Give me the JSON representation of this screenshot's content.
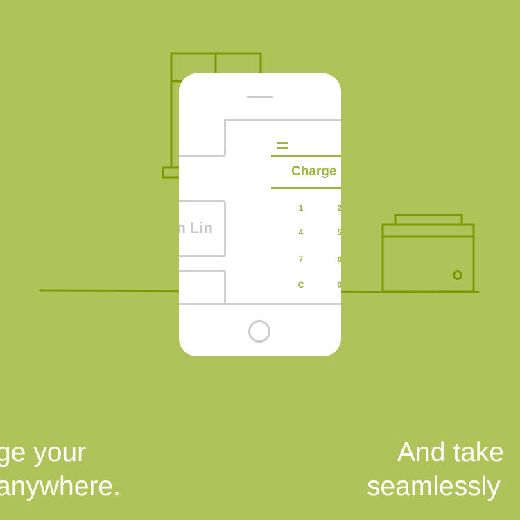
{
  "colors": {
    "background": "#b0c35a",
    "line_art": "#7a9a05",
    "accent": "#9cb43c",
    "phone": "#ffffff",
    "phone_gray": "#cfcfcf",
    "caption": "#ffffff"
  },
  "illustration": {
    "left_object_icon": "register-stand-icon",
    "right_object_icon": "cash-drawer-icon"
  },
  "phone_screen": {
    "menu_icon": "hamburger-menu-icon",
    "list_cards": [
      "",
      "n Lin",
      ""
    ],
    "charge_label": "Charge",
    "keypad": [
      [
        "1",
        "2"
      ],
      [
        "4",
        "5"
      ],
      [
        "7",
        "8"
      ],
      [
        "C",
        "0"
      ]
    ]
  },
  "captions": {
    "left_line1": "ge your",
    "left_line2": "anywhere.",
    "right_line1": "And take",
    "right_line2": "seamlessly"
  }
}
